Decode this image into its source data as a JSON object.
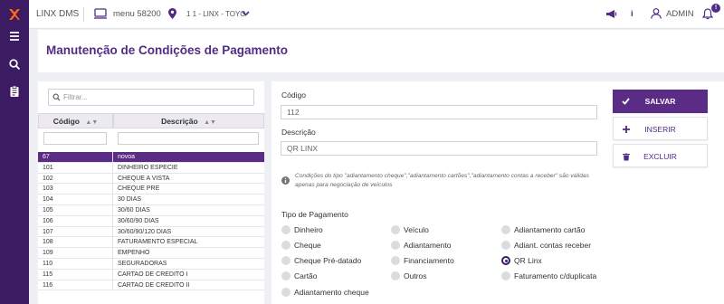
{
  "app": {
    "name": "LINX DMS",
    "menu": "menu 58200",
    "location": "1 1 - LINX - TOYO",
    "user": "ADMIN",
    "notification_badge": "!"
  },
  "page": {
    "title": "Manutenção de Condições de Pagamento"
  },
  "filter": {
    "placeholder": "Filtrar..."
  },
  "table": {
    "headers": [
      "Código",
      "Descrição"
    ],
    "rows": [
      {
        "code": "67",
        "desc": "novoa",
        "selected": true
      },
      {
        "code": "101",
        "desc": "DINHEIRO ESPECIE"
      },
      {
        "code": "102",
        "desc": "CHEQUE A VISTA"
      },
      {
        "code": "103",
        "desc": "CHEQUE PRE"
      },
      {
        "code": "104",
        "desc": "30 DIAS"
      },
      {
        "code": "105",
        "desc": "30/60 DIAS"
      },
      {
        "code": "106",
        "desc": "30/60/90 DIAS"
      },
      {
        "code": "107",
        "desc": "30/60/90/120 DIAS"
      },
      {
        "code": "108",
        "desc": "FATURAMENTO ESPECIAL"
      },
      {
        "code": "109",
        "desc": "EMPENHO"
      },
      {
        "code": "110",
        "desc": "SEGURADORAS"
      },
      {
        "code": "115",
        "desc": "CARTAO DE CREDITO I"
      },
      {
        "code": "116",
        "desc": "CARTAO DE CREDITO II"
      }
    ]
  },
  "form": {
    "code_label": "Código",
    "code_value": "112",
    "desc_label": "Descrição",
    "desc_value": "QR LINX",
    "note": "Condições do tipo \"adiantamento cheque\",\"adiantamento cartões\",\"adiantamento contas a receber\" são válidas apenas para negociação de veículos",
    "payment_label": "Tipo de Pagamento",
    "options": [
      {
        "label": "Dinheiro",
        "checked": false
      },
      {
        "label": "Veículo",
        "checked": false
      },
      {
        "label": "Adiantamento cartão",
        "checked": false
      },
      {
        "label": "Cheque",
        "checked": false
      },
      {
        "label": "Adiantamento",
        "checked": false
      },
      {
        "label": "Adiant. contas receber",
        "checked": false
      },
      {
        "label": "Cheque Pré-datado",
        "checked": false
      },
      {
        "label": "Financiamento",
        "checked": false
      },
      {
        "label": "QR Linx",
        "checked": true
      },
      {
        "label": "Cartão",
        "checked": false
      },
      {
        "label": "Outros",
        "checked": false
      },
      {
        "label": "Faturamento c/duplicata",
        "checked": false
      },
      {
        "label": "Adiantamento cheque",
        "checked": false
      }
    ]
  },
  "actions": {
    "save": "SALVAR",
    "insert": "INSERIR",
    "delete": "EXCLUIR"
  },
  "colors": {
    "brand": "#3b1b62",
    "accent": "#5b2c86",
    "logo": "#ff6a13"
  }
}
